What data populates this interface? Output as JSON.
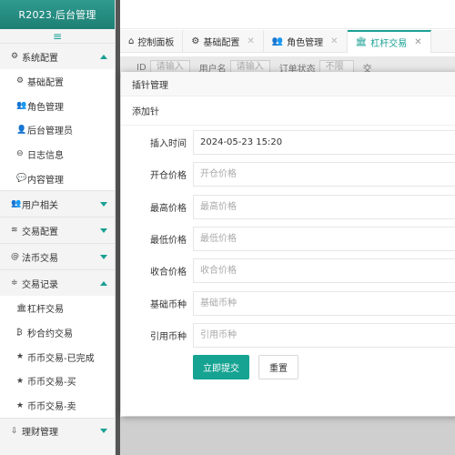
{
  "app": {
    "title": "R2023.后台管理",
    "menu_toggle": "≡"
  },
  "sidebar": {
    "groups": [
      {
        "label": "系统配置",
        "icon": "gear-icon",
        "glyph": "⚙",
        "expanded": true,
        "items": [
          {
            "label": "基础配置",
            "icon": "gear-icon",
            "glyph": "⚙"
          },
          {
            "label": "角色管理",
            "icon": "users-icon",
            "glyph": "👥"
          },
          {
            "label": "后台管理员",
            "icon": "user-icon",
            "glyph": "👤"
          },
          {
            "label": "日志信息",
            "icon": "minus-circle-icon",
            "glyph": "⊖"
          },
          {
            "label": "内容管理",
            "icon": "comment-icon",
            "glyph": "💬"
          }
        ]
      },
      {
        "label": "用户相关",
        "icon": "users-icon",
        "glyph": "👥",
        "expanded": false
      },
      {
        "label": "交易配置",
        "icon": "layers-icon",
        "glyph": "≋",
        "expanded": false
      },
      {
        "label": "法币交易",
        "icon": "at-icon",
        "glyph": "@",
        "expanded": false
      },
      {
        "label": "交易记录",
        "icon": "sliders-icon",
        "glyph": "≑",
        "expanded": true,
        "items": [
          {
            "label": "杠杆交易",
            "icon": "bank-icon",
            "glyph": "🏛"
          },
          {
            "label": "秒合约交易",
            "icon": "bitcoin-icon",
            "glyph": "₿"
          },
          {
            "label": "币币交易-已完成",
            "icon": "star-half-icon",
            "glyph": "★"
          },
          {
            "label": "币币交易-买",
            "icon": "star-half-icon",
            "glyph": "★"
          },
          {
            "label": "币币交易-卖",
            "icon": "star-half-icon",
            "glyph": "★"
          }
        ]
      },
      {
        "label": "理财管理",
        "icon": "download-icon",
        "glyph": "⇩",
        "expanded": false
      }
    ]
  },
  "tabs": [
    {
      "label": "控制面板",
      "icon": "home-icon",
      "glyph": "⌂",
      "closable": false,
      "active": false
    },
    {
      "label": "基础配置",
      "icon": "gear-icon",
      "glyph": "⚙",
      "closable": true,
      "active": false
    },
    {
      "label": "角色管理",
      "icon": "users-icon",
      "glyph": "👥",
      "closable": true,
      "active": false
    },
    {
      "label": "杠杆交易",
      "icon": "bank-icon",
      "glyph": "🏛",
      "closable": true,
      "active": true
    }
  ],
  "background": {
    "fields": [
      {
        "label": "ID",
        "placeholder": "请输入"
      },
      {
        "label": "用户名",
        "placeholder": "请输入"
      },
      {
        "label": "订单状态",
        "placeholder": "不限"
      },
      {
        "label": "交",
        "placeholder": ""
      }
    ]
  },
  "modal": {
    "title": "插针管理",
    "subtitle": "添加针",
    "fields": [
      {
        "label": "插入时间",
        "value": "2024-05-23 15:20",
        "placeholder": ""
      },
      {
        "label": "开仓价格",
        "value": "",
        "placeholder": "开仓价格"
      },
      {
        "label": "最高价格",
        "value": "",
        "placeholder": "最高价格"
      },
      {
        "label": "最低价格",
        "value": "",
        "placeholder": "最低价格"
      },
      {
        "label": "收合价格",
        "value": "",
        "placeholder": "收合价格"
      },
      {
        "label": "基础币种",
        "value": "",
        "placeholder": "基础币种"
      },
      {
        "label": "引用币种",
        "value": "",
        "placeholder": "引用币种"
      }
    ],
    "submit_label": "立即提交",
    "reset_label": "重置"
  },
  "colors": {
    "brand": "#1aa094",
    "header": "#2f9a8f",
    "submit": "#16a392"
  }
}
